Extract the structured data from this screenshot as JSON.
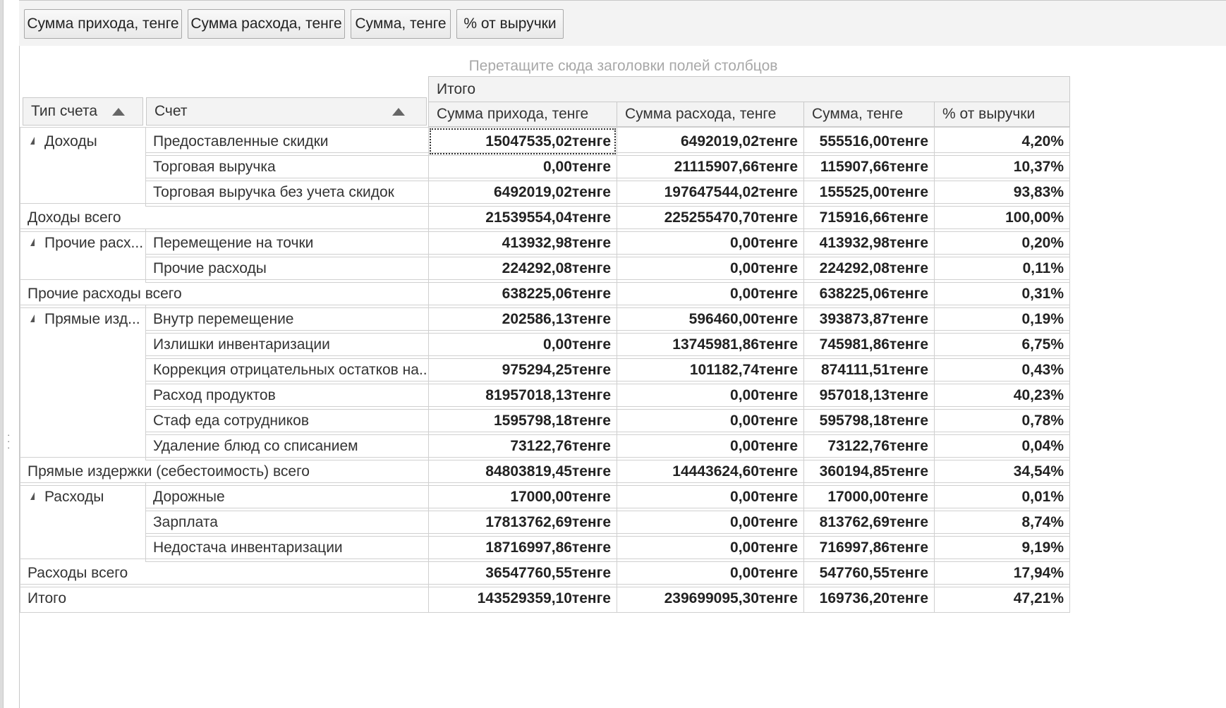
{
  "data_area_buttons": [
    "Сумма прихода, тенге",
    "Сумма расхода, тенге",
    "Сумма, тенге",
    "% от выручки"
  ],
  "column_drop_hint": "Перетащите сюда заголовки полей столбцов",
  "row_fields": {
    "account_type": "Тип счета",
    "account": "Счет"
  },
  "column_group_header": "Итого",
  "data_headers": [
    "Сумма прихода, тенге",
    "Сумма расхода, тенге",
    "Сумма, тенге",
    "% от выручки"
  ],
  "groups": [
    {
      "name": "Доходы",
      "rows": [
        {
          "account": "Предоставленные скидки",
          "values": [
            "15047535,02тенге",
            "6492019,02тенге",
            "555516,00тенге",
            "4,20%"
          ]
        },
        {
          "account": "Торговая выручка",
          "values": [
            "0,00тенге",
            "21115907,66тенге",
            "115907,66тенге",
            "10,37%"
          ]
        },
        {
          "account": "Торговая выручка без учета скидок",
          "values": [
            "6492019,02тенге",
            "197647544,02тенге",
            "155525,00тенге",
            "93,83%"
          ]
        }
      ],
      "total_label": "Доходы всего",
      "total_values": [
        "21539554,04тенге",
        "225255470,70тенге",
        "715916,66тенге",
        "100,00%"
      ]
    },
    {
      "name": "Прочие расх...",
      "rows": [
        {
          "account": "Перемещение на точки",
          "values": [
            "413932,98тенге",
            "0,00тенге",
            "413932,98тенге",
            "0,20%"
          ]
        },
        {
          "account": "Прочие расходы",
          "values": [
            "224292,08тенге",
            "0,00тенге",
            "224292,08тенге",
            "0,11%"
          ]
        }
      ],
      "total_label": "Прочие расходы всего",
      "total_values": [
        "638225,06тенге",
        "0,00тенге",
        "638225,06тенге",
        "0,31%"
      ]
    },
    {
      "name": "Прямые изд...",
      "rows": [
        {
          "account": "Внутр перемещение",
          "values": [
            "202586,13тенге",
            "596460,00тенге",
            "393873,87тенге",
            "0,19%"
          ]
        },
        {
          "account": "Излишки инвентаризации",
          "values": [
            "0,00тенге",
            "13745981,86тенге",
            "745981,86тенге",
            "6,75%"
          ]
        },
        {
          "account": "Коррекция отрицательных остатков на...",
          "values": [
            "975294,25тенге",
            "101182,74тенге",
            "874111,51тенге",
            "0,43%"
          ]
        },
        {
          "account": "Расход продуктов",
          "values": [
            "81957018,13тенге",
            "0,00тенге",
            "957018,13тенге",
            "40,23%"
          ]
        },
        {
          "account": "Стаф еда сотрудников",
          "values": [
            "1595798,18тенге",
            "0,00тенге",
            "595798,18тенге",
            "0,78%"
          ]
        },
        {
          "account": "Удаление блюд со списанием",
          "values": [
            "73122,76тенге",
            "0,00тенге",
            "73122,76тенге",
            "0,04%"
          ]
        }
      ],
      "total_label": "Прямые издержки (себестоимость) всего",
      "total_values": [
        "84803819,45тенге",
        "14443624,60тенге",
        "360194,85тенге",
        "34,54%"
      ]
    },
    {
      "name": "Расходы",
      "rows": [
        {
          "account": "Дорожные",
          "values": [
            "17000,00тенге",
            "0,00тенге",
            "17000,00тенге",
            "0,01%"
          ]
        },
        {
          "account": "Зарплата",
          "values": [
            "17813762,69тенге",
            "0,00тенге",
            "813762,69тенге",
            "8,74%"
          ]
        },
        {
          "account": "Недостача инвентаризации",
          "values": [
            "18716997,86тенге",
            "0,00тенге",
            "716997,86тенге",
            "9,19%"
          ]
        }
      ],
      "total_label": "Расходы всего",
      "total_values": [
        "36547760,55тенге",
        "0,00тенге",
        "547760,55тенге",
        "17,94%"
      ]
    }
  ],
  "grand_total": {
    "label": "Итого",
    "values": [
      "143529359,10тенге",
      "239699095,30тенге",
      "169736,20тенге",
      "47,21%"
    ]
  }
}
